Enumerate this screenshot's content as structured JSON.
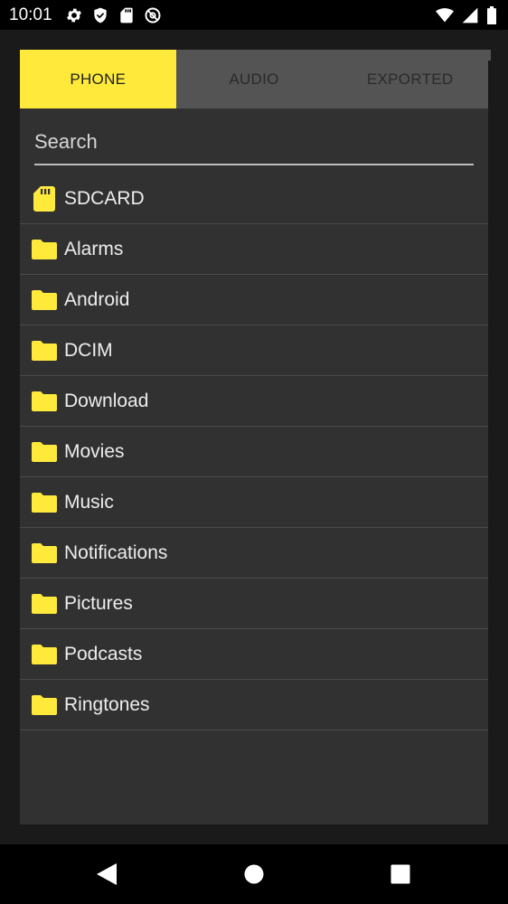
{
  "status_bar": {
    "time": "10:01",
    "left_icons": [
      "settings-icon",
      "shield-icon",
      "sd-card-icon",
      "at-sign-icon"
    ],
    "right_icons": [
      "wifi-icon",
      "signal-icon",
      "battery-icon"
    ]
  },
  "tabs": [
    {
      "label": "PHONE",
      "active": true
    },
    {
      "label": "AUDIO",
      "active": false
    },
    {
      "label": "EXPORTED",
      "active": false
    }
  ],
  "search": {
    "placeholder": "Search",
    "value": ""
  },
  "folders": [
    {
      "label": "SDCARD",
      "icon": "sd-card-icon"
    },
    {
      "label": "Alarms",
      "icon": "folder-icon"
    },
    {
      "label": "Android",
      "icon": "folder-icon"
    },
    {
      "label": "DCIM",
      "icon": "folder-icon"
    },
    {
      "label": "Download",
      "icon": "folder-icon"
    },
    {
      "label": "Movies",
      "icon": "folder-icon"
    },
    {
      "label": "Music",
      "icon": "folder-icon"
    },
    {
      "label": "Notifications",
      "icon": "folder-icon"
    },
    {
      "label": "Pictures",
      "icon": "folder-icon"
    },
    {
      "label": "Podcasts",
      "icon": "folder-icon"
    },
    {
      "label": "Ringtones",
      "icon": "folder-icon"
    }
  ],
  "nav_bar": [
    "back-icon",
    "home-icon",
    "recents-icon"
  ],
  "colors": {
    "accent": "#ffea3b",
    "dialog_bg": "#313131",
    "tab_inactive_bg": "#545454",
    "background": "#1a1a1a"
  }
}
